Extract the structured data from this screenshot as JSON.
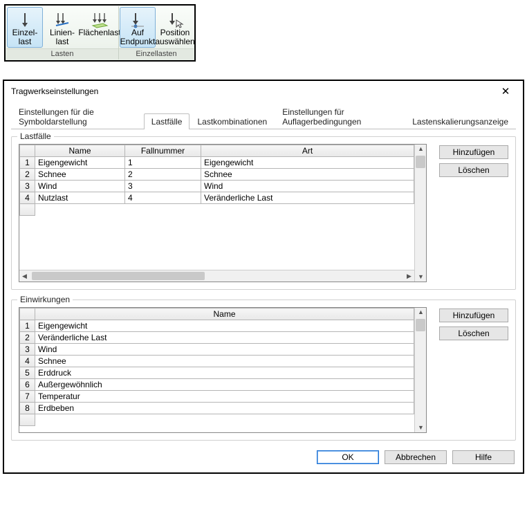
{
  "ribbon": {
    "groups": [
      {
        "label": "Lasten",
        "items": [
          {
            "id": "einzellast",
            "label_l1": "Einzel-",
            "label_l2": "last",
            "icon": "arrow-down",
            "selected": true
          },
          {
            "id": "linienlast",
            "label_l1": "Linien-",
            "label_l2": "last",
            "icon": "arrows-line",
            "selected": false
          },
          {
            "id": "flaechenlast",
            "label_l1": "Flächenlast",
            "label_l2": "",
            "icon": "arrows-plane",
            "selected": false
          }
        ]
      },
      {
        "label": "Einzellasten",
        "items": [
          {
            "id": "auf-endpunkt",
            "label_l1": "Auf",
            "label_l2": "Endpunkt",
            "icon": "arrow-to-point",
            "selected": true
          },
          {
            "id": "position-auswahl",
            "label_l1": "Position",
            "label_l2": "auswählen",
            "icon": "arrow-cursor",
            "selected": false
          }
        ]
      }
    ]
  },
  "dialog": {
    "title": "Tragwerkseinstellungen",
    "close": "✕",
    "tabs": {
      "t1": "Einstellungen für die Symboldarstellung",
      "t2": "Lastfälle",
      "t3": "Lastkombinationen",
      "t4": "Einstellungen für Auflagerbedingungen",
      "t5": "Lastenskalierungsanzeige",
      "active": "t2"
    },
    "lastfaelle": {
      "legend": "Lastfälle",
      "headers": {
        "name": "Name",
        "fallnummer": "Fallnummer",
        "art": "Art"
      },
      "rows": [
        {
          "n": "1",
          "name": "Eigengewicht",
          "nr": "1",
          "art": "Eigengewicht"
        },
        {
          "n": "2",
          "name": "Schnee",
          "nr": "2",
          "art": "Schnee"
        },
        {
          "n": "3",
          "name": "Wind",
          "nr": "3",
          "art": "Wind"
        },
        {
          "n": "4",
          "name": "Nutzlast",
          "nr": "4",
          "art": "Veränderliche Last"
        }
      ],
      "buttons": {
        "add": "Hinzufügen",
        "del": "Löschen"
      }
    },
    "einwirkungen": {
      "legend": "Einwirkungen",
      "headers": {
        "name": "Name"
      },
      "rows": [
        {
          "n": "1",
          "name": "Eigengewicht"
        },
        {
          "n": "2",
          "name": "Veränderliche Last"
        },
        {
          "n": "3",
          "name": "Wind"
        },
        {
          "n": "4",
          "name": "Schnee"
        },
        {
          "n": "5",
          "name": "Erddruck"
        },
        {
          "n": "6",
          "name": "Außergewöhnlich"
        },
        {
          "n": "7",
          "name": "Temperatur"
        },
        {
          "n": "8",
          "name": "Erdbeben"
        }
      ],
      "buttons": {
        "add": "Hinzufügen",
        "del": "Löschen"
      }
    },
    "footer": {
      "ok": "OK",
      "cancel": "Abbrechen",
      "help": "Hilfe"
    }
  }
}
